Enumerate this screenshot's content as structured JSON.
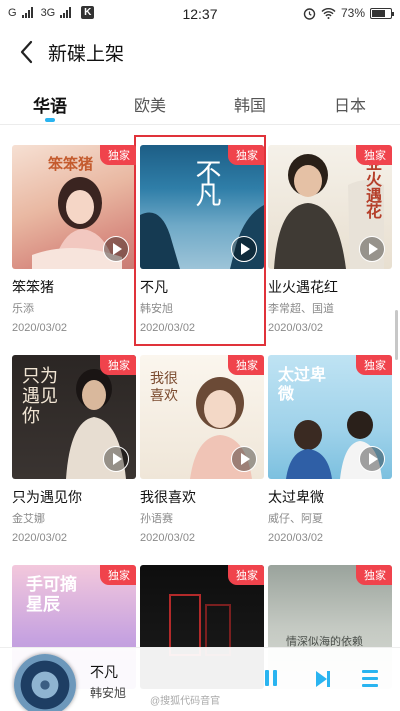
{
  "status_bar": {
    "network1": "G",
    "network2": "3G",
    "carrier_icon": "K",
    "time": "12:37",
    "battery_percent": "73%",
    "battery_level": 0.73,
    "icons": [
      "alarm-icon",
      "wifi-icon",
      "battery-icon"
    ]
  },
  "header": {
    "title": "新碟上架",
    "back_icon": "chevron-left-icon"
  },
  "tabs": [
    {
      "label": "华语",
      "active": true
    },
    {
      "label": "欧美",
      "active": false
    },
    {
      "label": "韩国",
      "active": false
    },
    {
      "label": "日本",
      "active": false
    }
  ],
  "albums": [
    {
      "title": "笨笨猪",
      "artist": "乐添",
      "date": "2020/03/02",
      "badge": "独家",
      "cover_text": "笨笨猪"
    },
    {
      "title": "不凡",
      "artist": "韩安旭",
      "date": "2020/03/02",
      "badge": "独家",
      "cover_text": "不凡"
    },
    {
      "title": "业火遇花红",
      "artist": "李常超、国道",
      "date": "2020/03/02",
      "badge": "独家",
      "cover_text": "业火遇花"
    },
    {
      "title": "只为遇见你",
      "artist": "金艾娜",
      "date": "2020/03/02",
      "badge": "独家",
      "cover_text": "只为遇见你"
    },
    {
      "title": "我很喜欢",
      "artist": "孙语赛",
      "date": "2020/03/02",
      "badge": "独家",
      "cover_text": "我很喜欢"
    },
    {
      "title": "太过卑微",
      "artist": "威仔、阿夏",
      "date": "2020/03/02",
      "badge": "独家",
      "cover_text": "太过卑微"
    },
    {
      "title": "",
      "artist": "",
      "date": "",
      "badge": "独家",
      "cover_text": "手可摘星辰"
    },
    {
      "title": "",
      "artist": "",
      "date": "",
      "badge": "独家",
      "cover_text": ""
    },
    {
      "title": "",
      "artist": "",
      "date": "",
      "badge": "独家",
      "cover_text": "情深似海的依赖"
    }
  ],
  "mini_player": {
    "title": "不凡",
    "artist": "韩安旭"
  },
  "watermark": "@搜狐代码音官"
}
